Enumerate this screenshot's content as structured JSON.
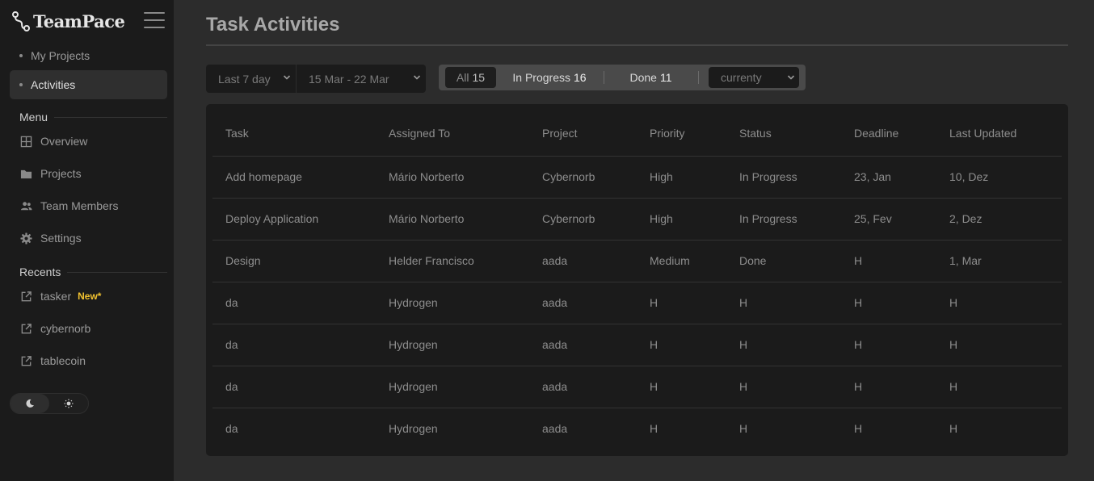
{
  "brand": {
    "name": "TeamPace"
  },
  "sidebar": {
    "projects_links": [
      {
        "label": "My Projects",
        "active": false
      },
      {
        "label": "Activities",
        "active": true
      }
    ],
    "menu_title": "Menu",
    "menu": [
      {
        "label": "Overview",
        "icon": "grid-icon"
      },
      {
        "label": "Projects",
        "icon": "folder-icon"
      },
      {
        "label": "Team Members",
        "icon": "users-icon"
      },
      {
        "label": "Settings",
        "icon": "gear-icon"
      }
    ],
    "recents_title": "Recents",
    "recents": [
      {
        "label": "tasker",
        "badge": "New*",
        "icon": "external-link-icon"
      },
      {
        "label": "cybernorb",
        "badge": "",
        "icon": "external-link-icon"
      },
      {
        "label": "tablecoin",
        "badge": "",
        "icon": "external-link-icon"
      }
    ],
    "theme": {
      "selected": "dark",
      "options": [
        "moon-icon",
        "sun-icon"
      ]
    }
  },
  "main": {
    "title": "Task Activities",
    "range_select": "Last 7 day",
    "date_select": "15 Mar - 22 Mar",
    "filters": [
      {
        "label": "All",
        "count": "15",
        "selected": true
      },
      {
        "label": "In Progress",
        "count": "16",
        "selected": false
      },
      {
        "label": "Done",
        "count": "11",
        "selected": false
      }
    ],
    "period_select": "currenty",
    "table": {
      "columns": [
        "Task",
        "Assigned To",
        "Project",
        "Priority",
        "Status",
        "Deadline",
        "Last Updated"
      ],
      "rows": [
        [
          "Add homepage",
          "Mário Norberto",
          "Cybernorb",
          "High",
          "In Progress",
          "23, Jan",
          "10, Dez"
        ],
        [
          "Deploy Application",
          "Mário Norberto",
          "Cybernorb",
          "High",
          "In Progress",
          "25, Fev",
          "2, Dez"
        ],
        [
          "Design",
          "Helder Francisco",
          "aada",
          "Medium",
          "Done",
          "H",
          "1, Mar"
        ],
        [
          "da",
          "Hydrogen",
          "aada",
          "H",
          "H",
          "H",
          "H"
        ],
        [
          "da",
          "Hydrogen",
          "aada",
          "H",
          "H",
          "H",
          "H"
        ],
        [
          "da",
          "Hydrogen",
          "aada",
          "H",
          "H",
          "H",
          "H"
        ],
        [
          "da",
          "Hydrogen",
          "aada",
          "H",
          "H",
          "H",
          "H"
        ]
      ]
    }
  },
  "colors": {
    "sidebar_bg": "#1b1b1b",
    "page_bg": "#2c2c2c",
    "badge_new": "#f2c230"
  }
}
